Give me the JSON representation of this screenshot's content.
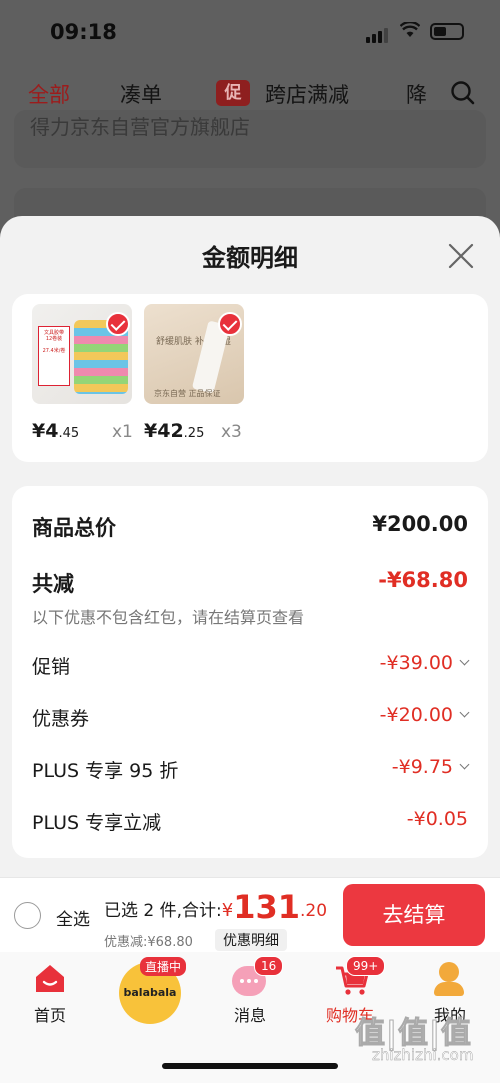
{
  "status_bar": {
    "time": "09:18"
  },
  "bg_tabs": {
    "all": "全部",
    "combine": "凑单",
    "promo_mark": "促",
    "cross_store": "跨店满减",
    "cut": "降"
  },
  "bg_store": "得力京东自营官方旗舰店",
  "sheet": {
    "title": "金额明细",
    "products": [
      {
        "price_int": "¥4",
        "price_dec": ".45",
        "qty": "x1"
      },
      {
        "price_int": "¥42",
        "price_dec": ".25",
        "qty": "x3"
      }
    ],
    "cream_text": "舒缓肌肤 补水保湿",
    "cream_sub": "京东自营 正品保证",
    "details": {
      "total_label": "商品总价",
      "total_value": "¥200.00",
      "discount_label": "共减",
      "discount_value": "-¥68.80",
      "note": "以下优惠不包含红包，请在结算页查看",
      "promo_label": "促销",
      "promo_value": "-¥39.00",
      "coupon_label": "优惠券",
      "coupon_value": "-¥20.00",
      "plus95_label": "PLUS 专享 95 折",
      "plus95_value": "-¥9.75",
      "plus_cut_label": "PLUS 专享立减",
      "plus_cut_value": "-¥0.05"
    }
  },
  "checkout": {
    "select_all": "全选",
    "selected": "已选 2 件,合计:",
    "yen": "¥",
    "total_int": "131",
    "total_dec": ".20",
    "discount": "优惠减:¥68.80",
    "detail_link": "优惠明细",
    "pay_button": "去结算"
  },
  "nav": {
    "home": "首页",
    "live_badge": "直播中",
    "brand": "balabala",
    "messages": "消息",
    "messages_badge": "16",
    "cart": "购物车",
    "cart_badge": "99+",
    "me": "我的"
  },
  "watermark": {
    "main": "值|值|值",
    "sub": "zhizhizhi.com"
  },
  "colors": {
    "accent": "#e02e24",
    "pay_button": "#ec3840",
    "overlay": "#5f5f5f"
  }
}
